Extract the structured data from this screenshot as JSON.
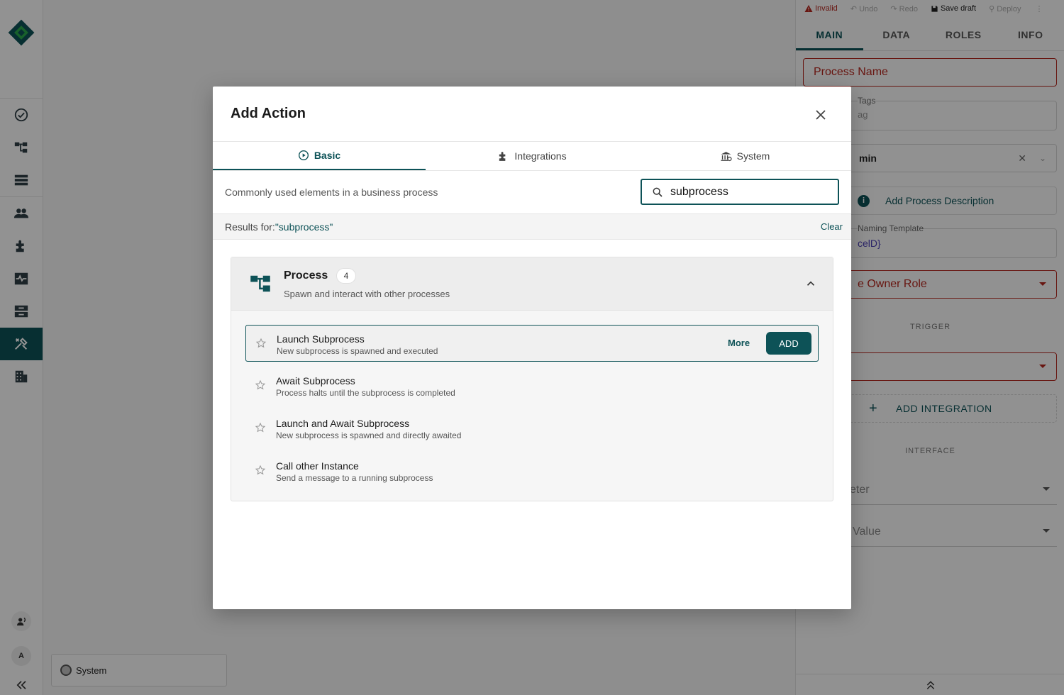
{
  "rail": {
    "nav_items": [
      "tasks-icon",
      "processes-icon",
      "list-icon",
      "users-icon",
      "integrations-icon",
      "monitoring-icon",
      "inbox-icon",
      "tools-icon",
      "organization-icon"
    ],
    "active_item": "tools-icon",
    "avatar_initial": "A"
  },
  "canvas": {
    "system_chip_label": "System"
  },
  "panel": {
    "toolbar": {
      "invalid": "Invalid",
      "undo": "Undo",
      "redo": "Redo",
      "save_draft": "Save draft",
      "deploy": "Deploy"
    },
    "tabs": [
      "MAIN",
      "DATA",
      "ROLES",
      "INFO"
    ],
    "active_tab": "MAIN",
    "process_name_placeholder": "Process Name",
    "tags_label": "Tags",
    "tags_placeholder": "ag",
    "admin_value": "min",
    "add_description": "Add Process Description",
    "naming_template_label": "Naming Template",
    "naming_template_value": "celD}",
    "owner_role": "e Owner Role",
    "trigger_section": "TRIGGER",
    "add_integration": "ADD INTEGRATION",
    "interface_section": "INTERFACE",
    "parameter_field": "eter",
    "value_field": "Value"
  },
  "modal": {
    "title": "Add Action",
    "tabs": [
      {
        "label": "Basic",
        "icon": "play-circle-icon",
        "active": true
      },
      {
        "label": "Integrations",
        "icon": "puzzle-icon",
        "active": false
      },
      {
        "label": "System",
        "icon": "bank-icon",
        "active": false
      }
    ],
    "description": "Commonly used elements in a business process",
    "search_value": "subprocess",
    "results_prefix": "Results for: ",
    "results_term": "\"subprocess\"",
    "clear_label": "Clear",
    "group": {
      "name": "Process",
      "count": "4",
      "description": "Spawn and interact with other processes",
      "items": [
        {
          "name": "Launch Subprocess",
          "description": "New subprocess is spawned and executed",
          "selected": true
        },
        {
          "name": "Await Subprocess",
          "description": "Process halts until the subprocess is completed",
          "selected": false
        },
        {
          "name": "Launch and Await Subprocess",
          "description": "New subprocess is spawned and directly awaited",
          "selected": false
        },
        {
          "name": "Call other Instance",
          "description": "Send a message to a running subprocess",
          "selected": false
        }
      ],
      "more_label": "More",
      "add_label": "ADD"
    }
  },
  "colors": {
    "accent": "#0d5257",
    "error": "#b3261e"
  }
}
